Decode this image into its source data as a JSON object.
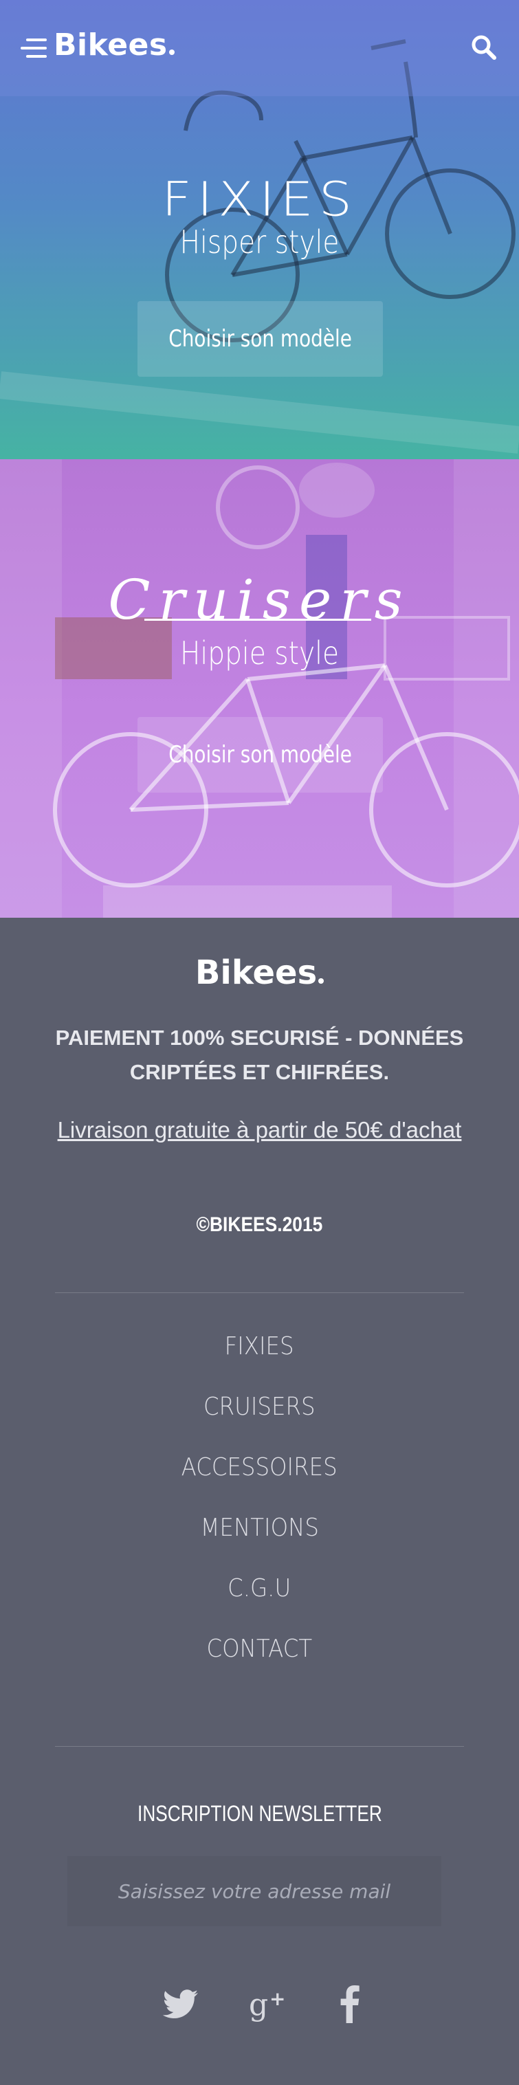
{
  "header": {
    "logo": "Bikees",
    "menu_icon": "hamburger-menu-icon",
    "search_icon": "search-icon"
  },
  "hero_fixies": {
    "title": "FIXIES",
    "subtitle": "Hisper style",
    "cta_label": "Choisir son modèle"
  },
  "hero_cruisers": {
    "title": "Cruisers",
    "subtitle": "Hippie style",
    "cta_label": "Choisir son modèle"
  },
  "footer": {
    "logo": "Bikees",
    "secure_text": "PAIEMENT 100% SECURISÉ - DONNÉES CRIPTÉES ET CHIFRÉES.",
    "delivery_text": "Livraison gratuite à partir de 50€ d'achat",
    "copyright": "©BIKEES.2015",
    "nav": [
      "FIXIES",
      "CRUISERS",
      "ACCESSOIRES",
      "MENTIONS",
      "C.G.U",
      "CONTACT"
    ],
    "newsletter_title": "INSCRIPTION NEWSLETTER",
    "newsletter_placeholder": "Saisissez votre adresse mail",
    "social_icons": [
      "twitter-icon",
      "google-plus-icon",
      "facebook-icon"
    ]
  },
  "colors": {
    "fixies_gradient_top": "#5a6fd0",
    "fixies_gradient_bottom": "#3fb0a0",
    "cruisers_tint": "#c284e2",
    "footer_bg": "#5b5e6d"
  }
}
